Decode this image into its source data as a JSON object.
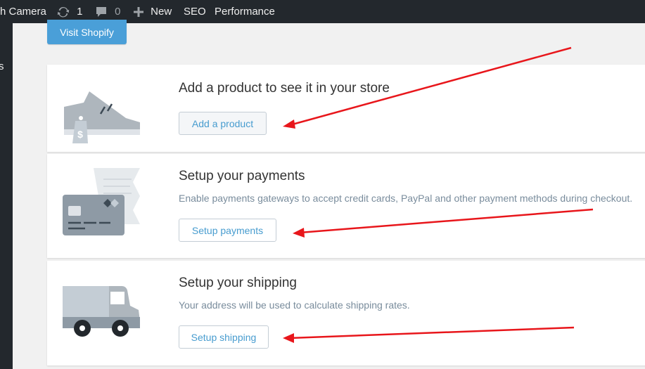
{
  "adminbar": {
    "site_name": "h Camera",
    "updates_count": "1",
    "comments_count": "0",
    "new_label": "New",
    "seo_label": "SEO",
    "performance_label": "Performance"
  },
  "sidebar": {
    "partial_text": "s"
  },
  "header": {
    "visit_button": "Visit Shopify"
  },
  "cards": [
    {
      "title": "Add a product to see it in your store",
      "button": "Add a product"
    },
    {
      "title": "Setup your payments",
      "description": "Enable payments gateways to accept credit cards, PayPal and other payment methods during checkout.",
      "button": "Setup payments"
    },
    {
      "title": "Setup your shipping",
      "description": "Your address will be used to calculate shipping rates.",
      "button": "Setup shipping"
    }
  ],
  "colors": {
    "adminbar": "#23282d",
    "primary_button": "#4a9fd8",
    "link_blue": "#479ccf",
    "annotation_arrow": "#e8161b"
  },
  "icons": [
    "updates-icon",
    "comment-icon",
    "plus-icon",
    "product-illustration",
    "payment-card-illustration",
    "delivery-truck-illustration"
  ]
}
